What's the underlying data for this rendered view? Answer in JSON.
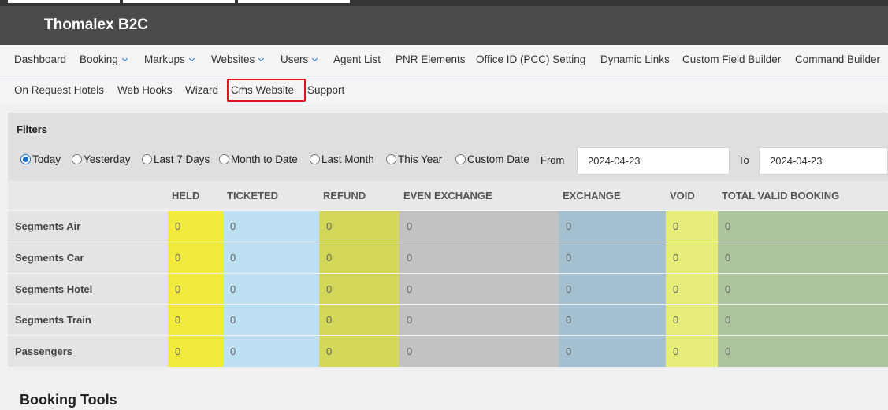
{
  "app": {
    "brand": "Thomalex B2C"
  },
  "nav_primary": [
    {
      "label": "Dashboard",
      "dropdown": false
    },
    {
      "label": "Booking",
      "dropdown": true
    },
    {
      "label": "Markups",
      "dropdown": true
    },
    {
      "label": "Websites",
      "dropdown": true
    },
    {
      "label": "Users",
      "dropdown": true
    },
    {
      "label": "Agent List",
      "dropdown": false
    },
    {
      "label": "PNR Elements",
      "dropdown": false
    },
    {
      "label": "Office ID (PCC) Setting",
      "dropdown": false
    },
    {
      "label": "Dynamic Links",
      "dropdown": false
    },
    {
      "label": "Custom Field Builder",
      "dropdown": false
    },
    {
      "label": "Command Builder",
      "dropdown": false
    }
  ],
  "nav_secondary": [
    {
      "label": "On Request Hotels"
    },
    {
      "label": "Web Hooks"
    },
    {
      "label": "Wizard"
    },
    {
      "label": "Cms Website",
      "highlighted": true
    },
    {
      "label": "Support"
    }
  ],
  "filters": {
    "title": "Filters",
    "options": [
      {
        "label": "Today",
        "checked": true
      },
      {
        "label": "Yesterday",
        "checked": false
      },
      {
        "label": "Last 7 Days",
        "checked": false
      },
      {
        "label": "Month to Date",
        "checked": false
      },
      {
        "label": "Last Month",
        "checked": false
      },
      {
        "label": "This Year",
        "checked": false
      },
      {
        "label": "Custom Date",
        "checked": false
      }
    ],
    "from_label": "From",
    "from_value": "2024-04-23",
    "to_label": "To",
    "to_value": "2024-04-23"
  },
  "summary_table": {
    "columns": [
      {
        "label": "HELD",
        "color": "#f3ea3e"
      },
      {
        "label": "TICKETED",
        "color": "#bde0f3"
      },
      {
        "label": "REFUND",
        "color": "#d4d85a"
      },
      {
        "label": "EVEN EXCHANGE",
        "color": "#c2c2c2"
      },
      {
        "label": "EXCHANGE",
        "color": "#a5c0d0"
      },
      {
        "label": "VOID",
        "color": "#e6ee79"
      },
      {
        "label": "TOTAL VALID BOOKING",
        "color": "#adc49c"
      }
    ],
    "rows": [
      {
        "label": "Segments Air",
        "values": [
          "0",
          "0",
          "0",
          "0",
          "0",
          "0",
          "0"
        ]
      },
      {
        "label": "Segments Car",
        "values": [
          "0",
          "0",
          "0",
          "0",
          "0",
          "0",
          "0"
        ]
      },
      {
        "label": "Segments Hotel",
        "values": [
          "0",
          "0",
          "0",
          "0",
          "0",
          "0",
          "0"
        ]
      },
      {
        "label": "Segments Train",
        "values": [
          "0",
          "0",
          "0",
          "0",
          "0",
          "0",
          "0"
        ]
      },
      {
        "label": "Passengers",
        "values": [
          "0",
          "0",
          "0",
          "0",
          "0",
          "0",
          "0"
        ]
      }
    ]
  },
  "booking_tools": {
    "title": "Booking Tools"
  }
}
